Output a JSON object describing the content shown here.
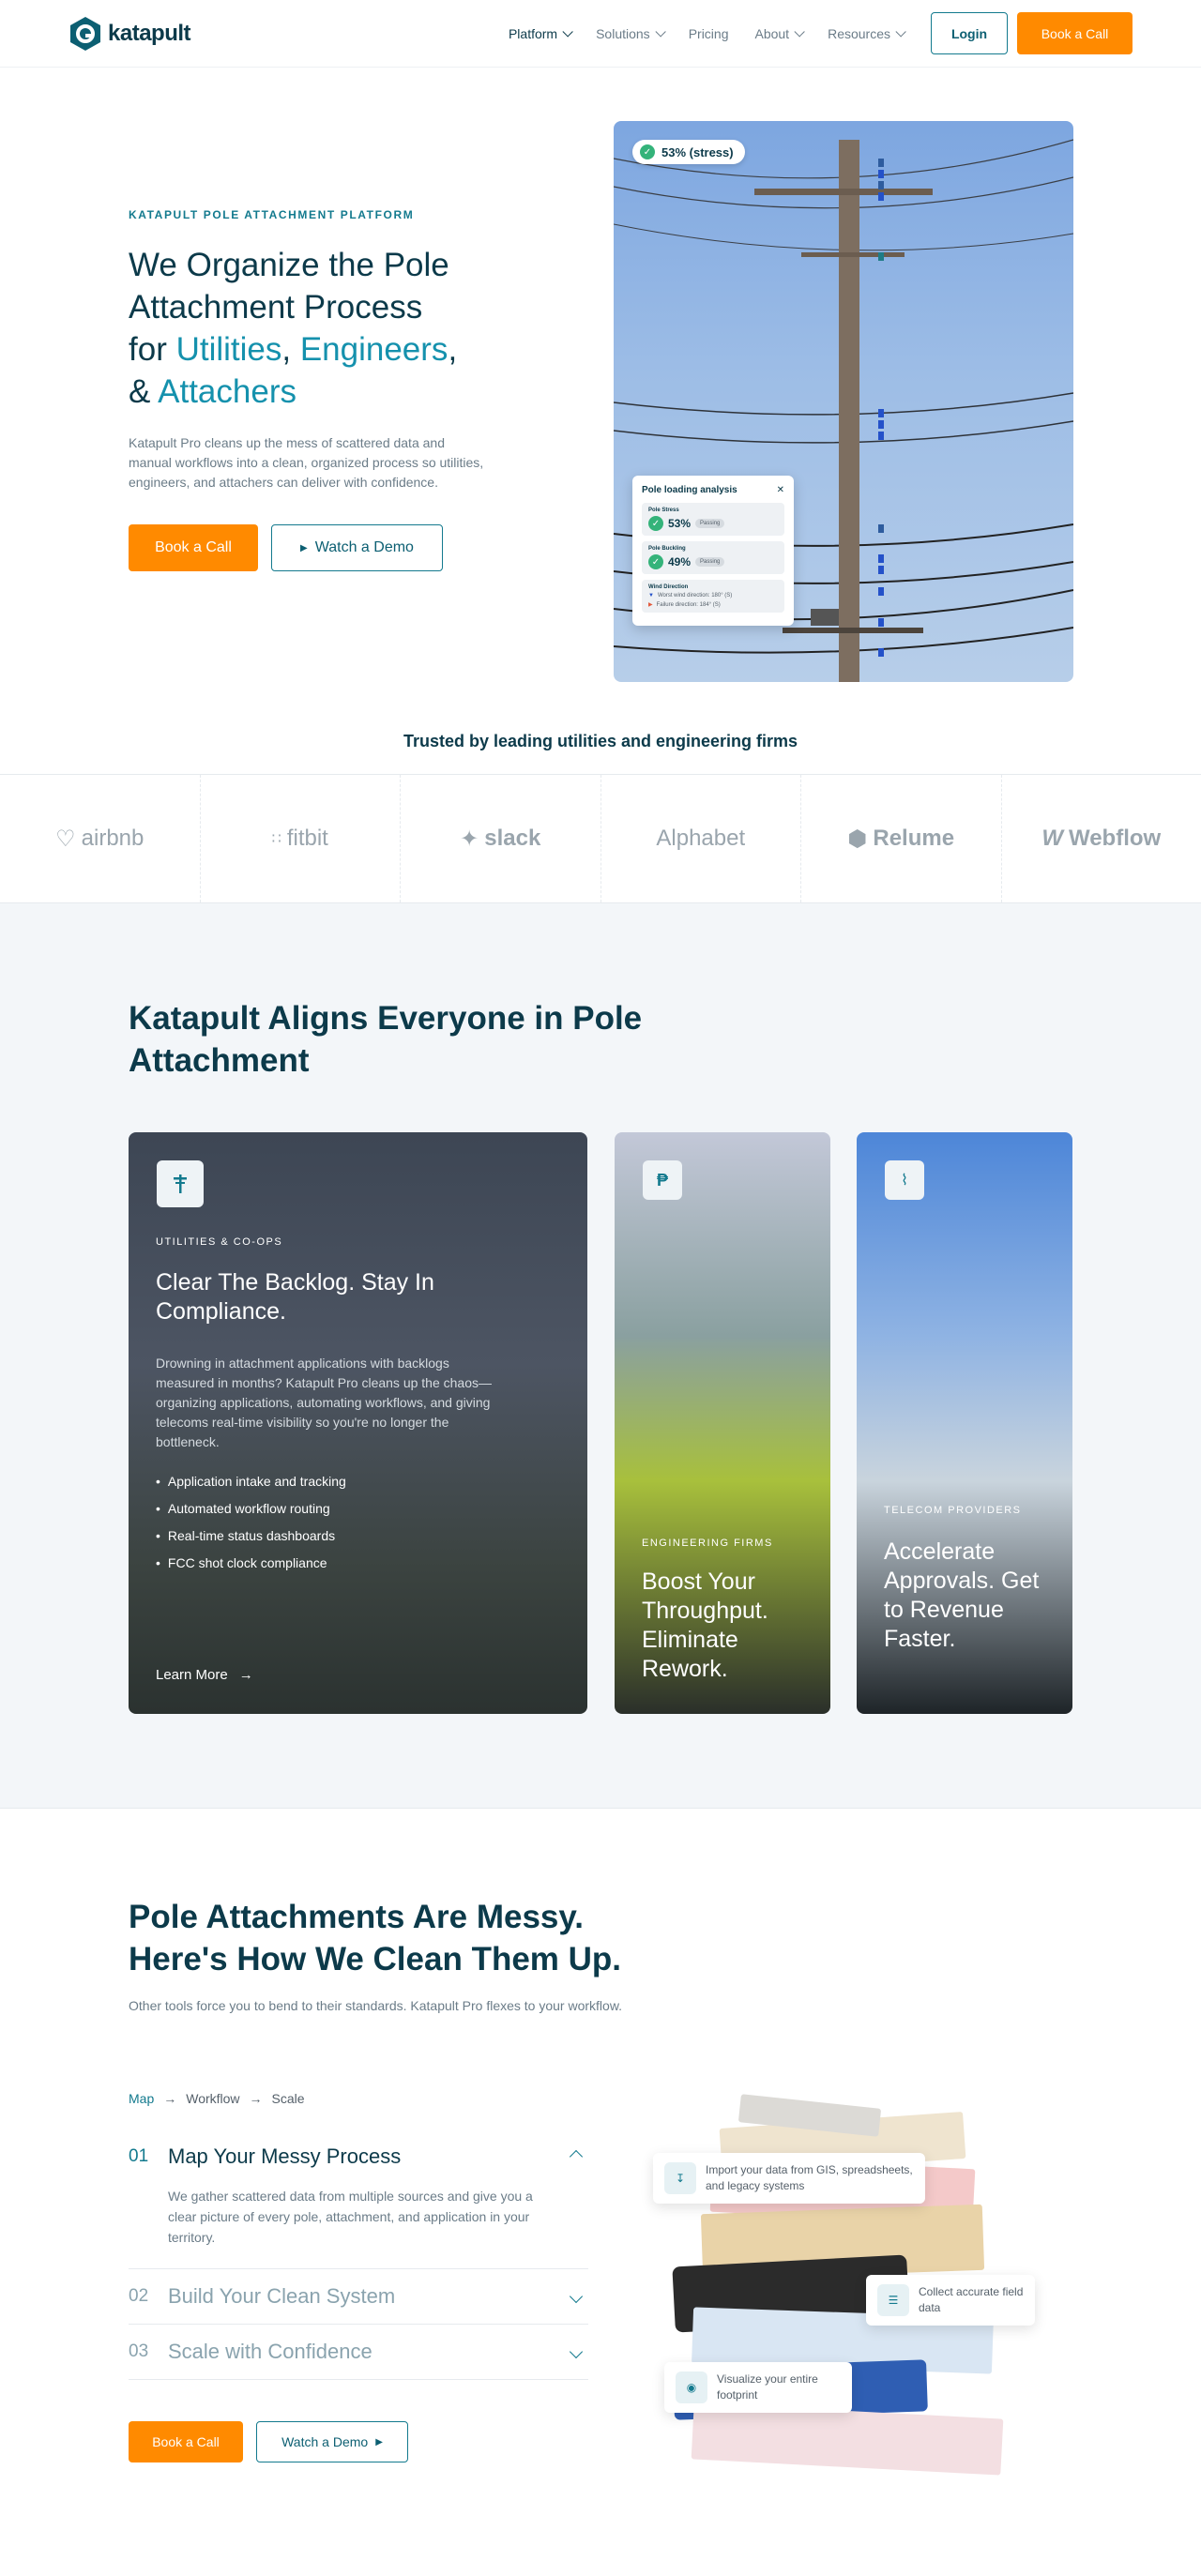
{
  "nav": {
    "logo_text": "katapult",
    "items": [
      {
        "label": "Platform",
        "dropdown": true
      },
      {
        "label": "Solutions",
        "dropdown": true
      },
      {
        "label": "Pricing",
        "dropdown": false
      },
      {
        "label": "About",
        "dropdown": true
      },
      {
        "label": "Resources",
        "dropdown": true
      }
    ],
    "login": "Login",
    "book": "Book a Call"
  },
  "hero": {
    "eyebrow": "KATAPULT POLE ATTACHMENT PLATFORM",
    "title_line1": "We Organize the Pole",
    "title_line2": "Attachment Process",
    "title_for": "for ",
    "utilities": "Utilities",
    "comma1": ", ",
    "engineers": "Engineers",
    "comma2": ",",
    "amp": "& ",
    "attachers": "Attachers",
    "desc": "Katapult Pro cleans up the mess of scattered data and manual workflows into a clean, organized process so utilities, engineers, and attachers can deliver with confidence.",
    "book": "Book a Call",
    "demo": "Watch a Demo",
    "stress_pill": "53% (stress)",
    "panel": {
      "title": "Pole loading analysis",
      "stress_label": "Pole Stress",
      "stress_value": "53%",
      "buckling_label": "Pole Buckling",
      "buckling_value": "49%",
      "passing": "Passing",
      "wind_label": "Wind Direction",
      "worst": "Worst wind direction: 180° (S)",
      "failure": "Failure direction: 184° (S)"
    }
  },
  "trusted": {
    "title": "Trusted by leading utilities and engineering firms",
    "logos": [
      "airbnb",
      "fitbit",
      "slack",
      "Alphabet",
      "Relume",
      "Webflow"
    ]
  },
  "align": {
    "title": "Katapult Aligns Everyone in Pole Attachment",
    "cards": [
      {
        "eyebrow": "UTILITIES & CO-OPS",
        "title": "Clear The Backlog. Stay In Compliance.",
        "desc": "Drowning in attachment applications with backlogs measured in months? Katapult Pro cleans up the chaos—organizing applications, automating workflows, and giving telecoms real-time visibility so you're no longer the bottleneck.",
        "bullets": [
          "Application intake and tracking",
          "Automated workflow routing",
          "Real-time status dashboards",
          "FCC shot clock compliance"
        ],
        "cta": "Learn More"
      },
      {
        "eyebrow": "ENGINEERING FIRMS",
        "title": "Boost Your Throughput. Eliminate Rework."
      },
      {
        "eyebrow": "TELECOM PROVIDERS",
        "title": "Accelerate Approvals. Get to Revenue Faster."
      }
    ]
  },
  "messy": {
    "title_line1": "Pole Attachments Are Messy.",
    "title_line2": "Here's How We Clean Them Up.",
    "subtitle": "Other tools force you to bend to their standards. Katapult Pro flexes to your workflow.",
    "breadcrumb": [
      "Map",
      "Workflow",
      "Scale"
    ],
    "steps": [
      {
        "num": "01",
        "title": "Map Your Messy Process",
        "desc": "We gather scattered data from multiple sources and give you a clear picture of every pole, attachment, and application in your territory."
      },
      {
        "num": "02",
        "title": "Build Your Clean System"
      },
      {
        "num": "03",
        "title": "Scale with Confidence"
      }
    ],
    "book": "Book a Call",
    "demo": "Watch a Demo",
    "floats": [
      "Import your data from GIS, spreadsheets, and legacy systems",
      "Collect accurate field data",
      "Visualize your entire footprint"
    ]
  }
}
